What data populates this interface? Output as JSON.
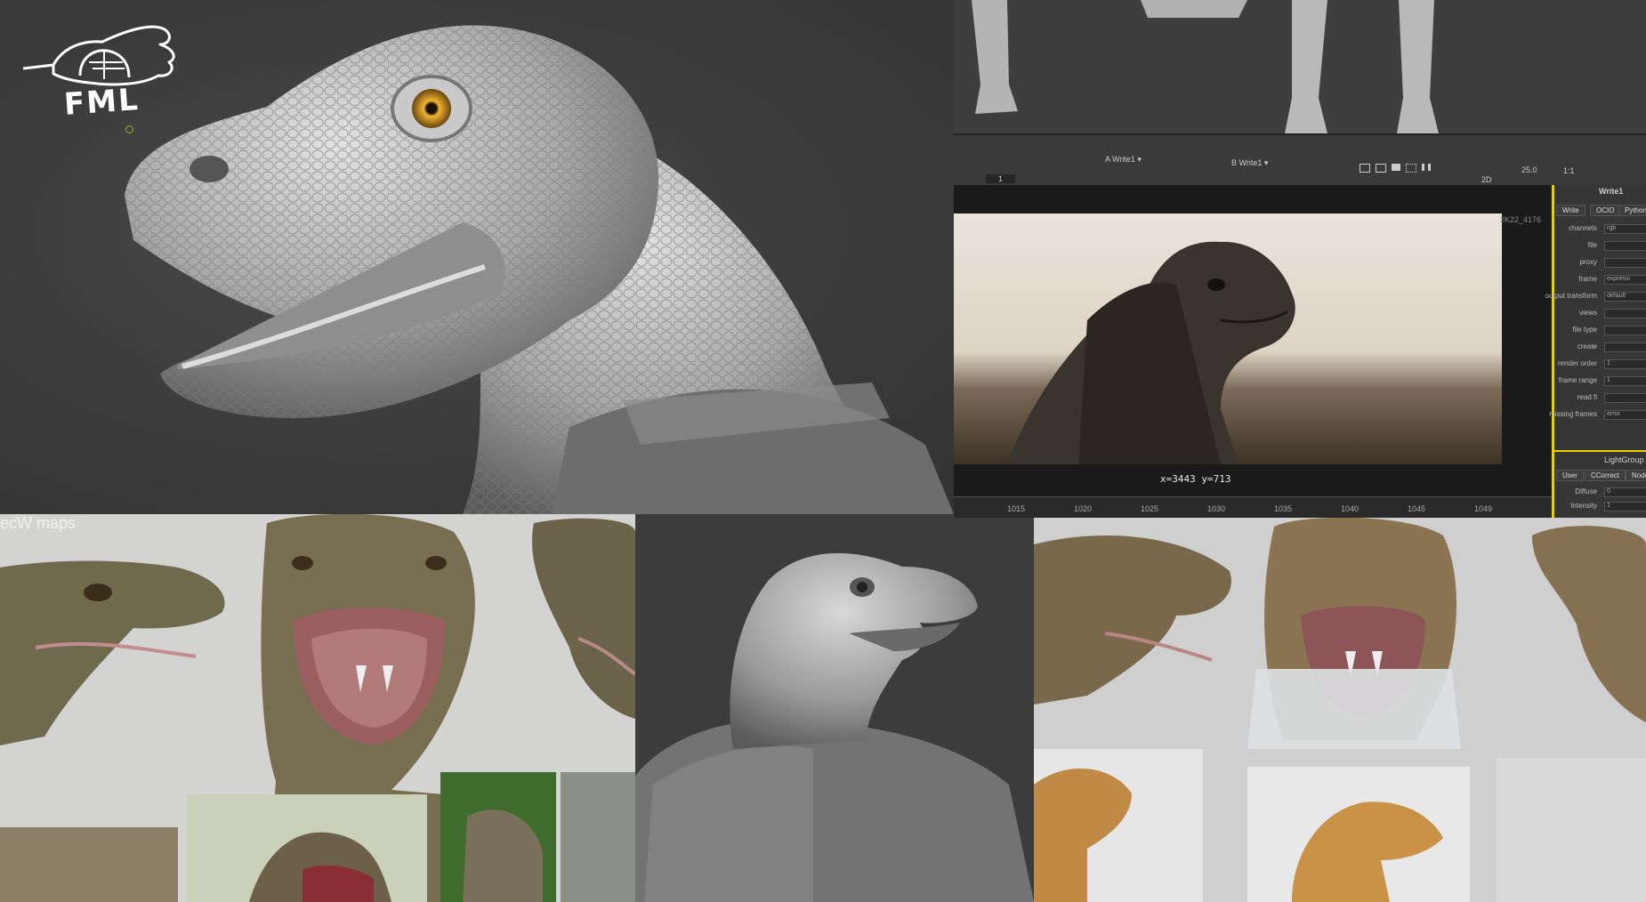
{
  "logo": {
    "text": "FML"
  },
  "viewer": {
    "input_a": "Write1",
    "input_b": "Write1",
    "frame_field": "1",
    "readout": "x=3443 y=713",
    "fps": "25.0",
    "zoom": "1:1",
    "view_mode": "2D",
    "resolution_label": "2K22_4176",
    "timeline_ticks": [
      "1015",
      "1020",
      "1025",
      "1030",
      "1035",
      "1040",
      "1045",
      "1049"
    ]
  },
  "properties": {
    "node_title": "Write1",
    "tabs": [
      "Write",
      "OCIO",
      "Python"
    ],
    "rows": [
      {
        "label": "channels",
        "value": "rgb"
      },
      {
        "label": "file",
        "value": ""
      },
      {
        "label": "proxy",
        "value": ""
      },
      {
        "label": "frame",
        "value": "expressi"
      },
      {
        "label": "output transform",
        "value": "default"
      },
      {
        "label": "views",
        "value": ""
      },
      {
        "label": "file type",
        "value": ""
      },
      {
        "label": "create",
        "value": ""
      },
      {
        "label": "render order",
        "value": "1"
      },
      {
        "label": "frame range",
        "value": "1"
      },
      {
        "label": "read fi",
        "value": ""
      },
      {
        "label": "missing frames",
        "value": "error"
      }
    ],
    "lower_tabs": [
      "User",
      "CCorrect",
      "Node"
    ],
    "lower_rows": [
      {
        "label": "Diffuse",
        "value": "0"
      },
      {
        "label": "Intensity",
        "value": "1"
      }
    ],
    "lower_title": "LightGroup"
  },
  "maps_label": "ecW maps",
  "colors": {
    "sculpt_bg": "#3b3b3b",
    "clay": "#bdbdbd",
    "eye": "#d69a1e",
    "viewer_frame": "#1e1e1e",
    "panel_accent": "#e5d200"
  }
}
